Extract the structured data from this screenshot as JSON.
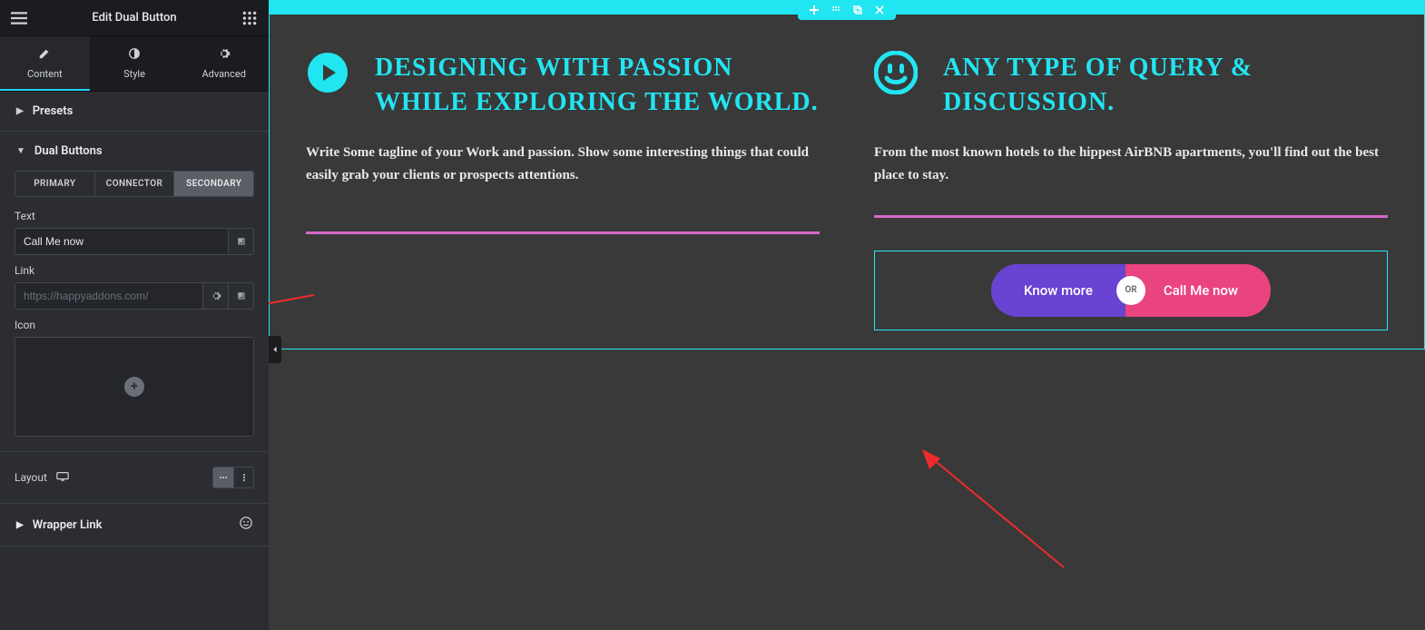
{
  "header": {
    "title": "Edit Dual Button"
  },
  "tabs": {
    "content": "Content",
    "style": "Style",
    "advanced": "Advanced"
  },
  "sections": {
    "presets": "Presets",
    "dual_buttons": "Dual Buttons",
    "layout": "Layout",
    "wrapper_link": "Wrapper Link"
  },
  "button_tabs": {
    "primary": "PRIMARY",
    "connector": "CONNECTOR",
    "secondary": "SECONDARY"
  },
  "fields": {
    "text_label": "Text",
    "text_value": "Call Me now",
    "link_label": "Link",
    "link_placeholder": "https://happyaddons.com/",
    "icon_label": "Icon"
  },
  "canvas": {
    "left": {
      "title": "DESIGNING WITH PASSION WHILE EXPLORING THE WORLD.",
      "text": "Write Some tagline of your Work and passion. Show some interesting things that could easily grab your clients or prospects attentions."
    },
    "right": {
      "title": "ANY TYPE OF QUERY & DISCUSSION.",
      "text": "From the most known hotels to the hippest AirBNB apartments, you'll find out the best place to stay."
    },
    "dual": {
      "primary": "Know more",
      "connector": "OR",
      "secondary": "Call Me now"
    }
  }
}
